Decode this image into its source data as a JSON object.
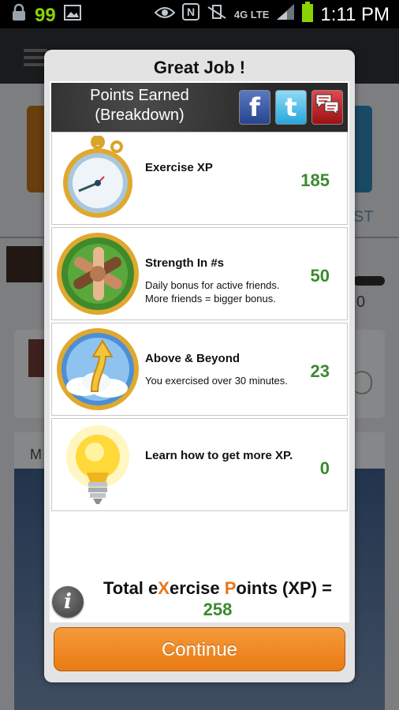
{
  "status_bar": {
    "notification_count": "99",
    "network": "4G LTE",
    "time": "1:11 PM"
  },
  "background": {
    "partial_text_st": "ST",
    "partial_text_zero": "0",
    "partial_text_m": "M"
  },
  "dialog": {
    "title": "Great Job !",
    "banner_title_line1": "Points Earned",
    "banner_title_line2": "(Breakdown)",
    "social": [
      {
        "label": "f"
      },
      {
        "label": "t"
      }
    ],
    "rows": [
      {
        "title": "Exercise XP",
        "description": "",
        "points": "185",
        "icon": "stopwatch-icon"
      },
      {
        "title": "Strength In #s",
        "description": "Daily bonus for active friends. More friends = bigger bonus.",
        "points": "50",
        "icon": "linked-hands-icon"
      },
      {
        "title": "Above & Beyond",
        "description": "You exercised over 30 minutes.",
        "points": "23",
        "icon": "arrow-up-clouds-icon"
      },
      {
        "title": "Learn how to get more XP.",
        "description": "",
        "points": "0",
        "icon": "lightbulb-icon"
      }
    ],
    "total": {
      "part1": "Total e",
      "part2": "X",
      "part3": "ercise ",
      "part4": "P",
      "part5": "oints (XP) =",
      "value": "258"
    },
    "info_label": "i",
    "continue_label": "Continue"
  },
  "colors": {
    "points_green": "#3b8a2e",
    "accent_orange": "#e97a14"
  }
}
